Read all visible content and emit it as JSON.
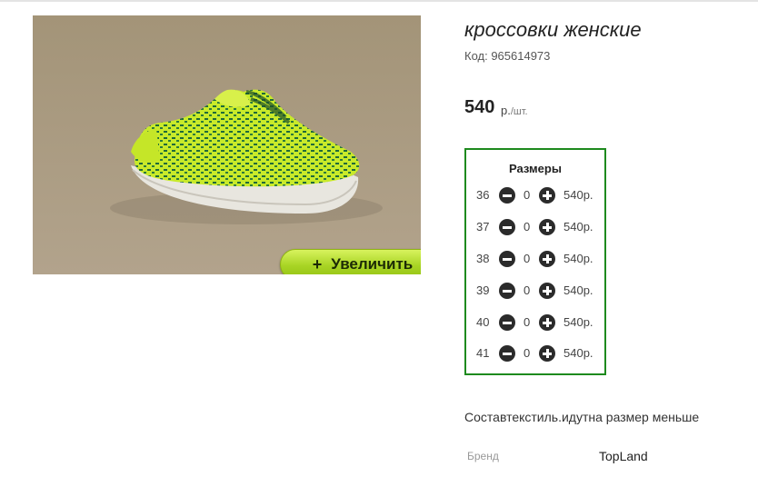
{
  "product": {
    "title": "кроссовки женские",
    "code": "Код: 965614973",
    "price": "540",
    "price_currency": "р.",
    "price_per": "/шт.",
    "description": "Составтекстиль.идутна размер меньше"
  },
  "image": {
    "zoom_plus": "+",
    "zoom_label": "Увеличить"
  },
  "sizes": {
    "title": "Размеры",
    "rows": [
      {
        "size": "36",
        "qty": "0",
        "price": "540р."
      },
      {
        "size": "37",
        "qty": "0",
        "price": "540р."
      },
      {
        "size": "38",
        "qty": "0",
        "price": "540р."
      },
      {
        "size": "39",
        "qty": "0",
        "price": "540р."
      },
      {
        "size": "40",
        "qty": "0",
        "price": "540р."
      },
      {
        "size": "41",
        "qty": "0",
        "price": "540р."
      }
    ]
  },
  "specs": {
    "brand_label": "Бренд",
    "brand_value": "TopLand"
  },
  "colors": {
    "accent_border": "#1e8a1e",
    "zoom_button": "#a8d424",
    "photo_background": "#a99a83"
  }
}
